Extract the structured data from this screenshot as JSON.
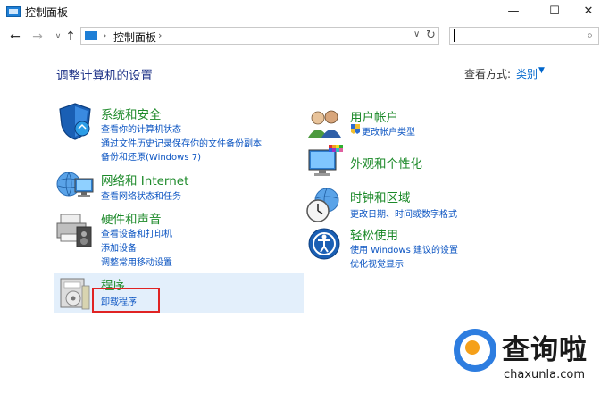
{
  "window": {
    "title": "控制面板",
    "controls": {
      "minimize": "—",
      "maximize": "☐",
      "close": "✕"
    }
  },
  "nav": {
    "back": "←",
    "forward": "→",
    "recent": "∨",
    "up": "↑",
    "breadcrumb": "控制面板",
    "sep": "›",
    "dropdown": "∨",
    "refresh": "↻",
    "search_value": "",
    "search_icon": "⌕"
  },
  "header": {
    "title": "调整计算机的设置",
    "view_label": "查看方式:",
    "view_value": "类别",
    "view_arrow": "▼"
  },
  "left_categories": [
    {
      "title": "系统和安全",
      "links": [
        "查看你的计算机状态",
        "通过文件历史记录保存你的文件备份副本",
        "备份和还原(Windows 7)"
      ]
    },
    {
      "title": "网络和 Internet",
      "links": [
        "查看网络状态和任务"
      ]
    },
    {
      "title": "硬件和声音",
      "links": [
        "查看设备和打印机",
        "添加设备",
        "调整常用移动设置"
      ]
    },
    {
      "title": "程序",
      "links": [
        "卸载程序"
      ]
    }
  ],
  "right_categories": [
    {
      "title": "用户帐户",
      "links": [
        "更改帐户类型"
      ]
    },
    {
      "title": "外观和个性化",
      "links": []
    },
    {
      "title": "时钟和区域",
      "links": [
        "更改日期、时间或数字格式"
      ]
    },
    {
      "title": "轻松使用",
      "links": [
        "使用 Windows 建议的设置",
        "优化视觉显示"
      ]
    }
  ],
  "watermark": {
    "cn": "查询啦",
    "en": "chaxunla.com"
  },
  "colors": {
    "accent": "#0b54c2",
    "category": "#1d8a2a",
    "heading": "#1e3287",
    "highlight": "#e3effb",
    "red_box": "#e02323"
  }
}
